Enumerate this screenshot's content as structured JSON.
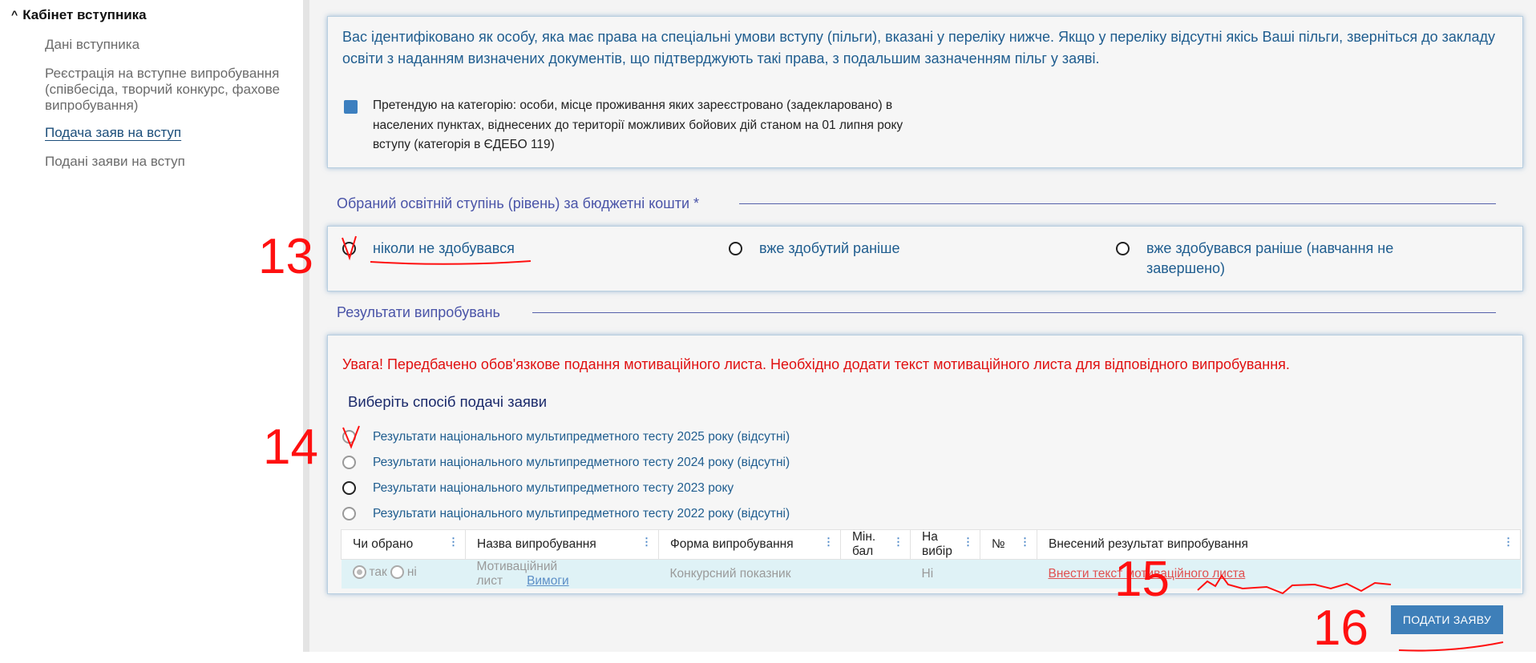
{
  "sidebar": {
    "title": "Кабінет вступника",
    "items": [
      {
        "label": "Дані вступника"
      },
      {
        "label": "Реєстрація на вступне випробування (співбесіда, творчий конкурс, фахове випробування)"
      },
      {
        "label": "Подача заяв на вступ"
      },
      {
        "label": "Подані заяви на вступ"
      }
    ]
  },
  "info": {
    "text": "Вас ідентифіковано як особу, яка має права на спеціальні умови вступу (пільги), вказані у переліку нижче. Якщо у переліку відсутні якісь Ваші пільги, зверніться до закладу освіти з наданням визначених документів, що підтверджують такі права, з подальшим зазначенням пільг у заяві.",
    "pretend_text": "Претендую на категорію: особи, місце проживання яких зареєстровано (задекларовано) в населених пунктах, віднесених до території можливих бойових дій станом на 01 липня року вступу (категорія в ЄДЕБО 119)"
  },
  "education": {
    "title": "Обраний освітній ступінь (рівень) за бюджетні кошти *",
    "options": [
      {
        "label": "ніколи не здобувався"
      },
      {
        "label": "вже здобутий раніше"
      },
      {
        "label": "вже здобувався раніше (навчання не завершено)"
      }
    ]
  },
  "results": {
    "title": "Результати випробувань",
    "warning": "Увага! Передбачено обов'язкове подання мотиваційного листа. Необхідно додати текст мотиваційного листа для відповідного випробування.",
    "choose_title": "Виберіть спосіб подачі заяви",
    "tests": [
      {
        "label": "Результати національного мультипредметного тесту 2025 року (відсутні)"
      },
      {
        "label": "Результати національного мультипредметного тесту 2024 року (відсутні)"
      },
      {
        "label": "Результати національного мультипредметного тесту 2023 року"
      },
      {
        "label": "Результати національного мультипредметного тесту 2022 року (відсутні)"
      }
    ],
    "table": {
      "headers": [
        "Чи обрано",
        "Назва випробування",
        "Форма випробування",
        "Мін. бал",
        "На вибір",
        "№",
        "Внесений результат випробування"
      ],
      "row": {
        "yes": "так",
        "no": "ні",
        "name": "Мотиваційний лист",
        "requirements": "Вимоги",
        "form": "Конкурсний показник",
        "min": "",
        "choice": "Ні",
        "num": "",
        "result_link": "Внести текст мотиваційного листа"
      }
    }
  },
  "submit_label": "ПОДАТИ ЗАЯВУ",
  "annotations": [
    "13",
    "14",
    "15",
    "16"
  ]
}
